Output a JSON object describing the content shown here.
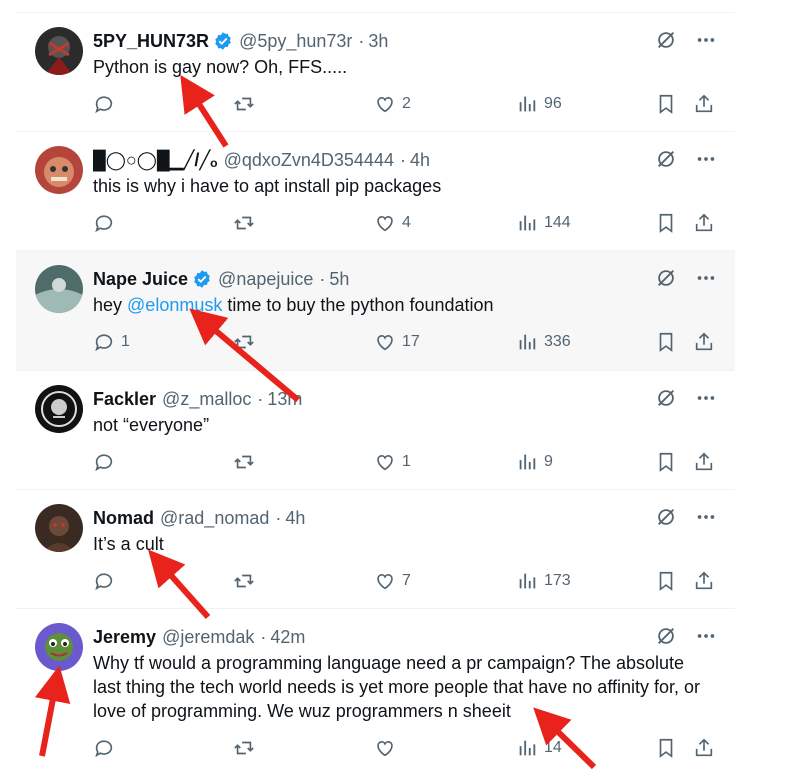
{
  "tweets": [
    {
      "name": "5PY_HUN73R",
      "verified": true,
      "handle": "@5py_hun73r",
      "time": "3h",
      "text": "Python is gay now? Oh, FFS.....",
      "mention": "",
      "text_after": "",
      "replies": "",
      "likes": "2",
      "views": "96",
      "avatar_color": "#2b2b2b",
      "highlight": false
    },
    {
      "name": "█◯○◯█▁╱/╱ₒ",
      "verified": false,
      "handle": "@qdxoZvn4D354444",
      "time": "4h",
      "text": "this is why i have to apt install pip packages",
      "mention": "",
      "text_after": "",
      "replies": "",
      "likes": "4",
      "views": "144",
      "avatar_color": "#b5453a",
      "highlight": false
    },
    {
      "name": "Nape Juice",
      "verified": true,
      "handle": "@napejuice",
      "time": "5h",
      "text": "hey ",
      "mention": "@elonmusk",
      "text_after": " time to buy the python foundation",
      "replies": "1",
      "likes": "17",
      "views": "336",
      "avatar_color": "#4f6b6a",
      "highlight": true
    },
    {
      "name": "Fackler",
      "verified": false,
      "handle": "@z_malloc",
      "time": "13m",
      "text": "not “everyone”",
      "mention": "",
      "text_after": "",
      "replies": "",
      "likes": "1",
      "views": "9",
      "avatar_color": "#111111",
      "highlight": false
    },
    {
      "name": "Nomad",
      "verified": false,
      "handle": "@rad_nomad",
      "time": "4h",
      "text": "It’s a cult",
      "mention": "",
      "text_after": "",
      "replies": "",
      "likes": "7",
      "views": "173",
      "avatar_color": "#3b2a22",
      "highlight": false
    },
    {
      "name": "Jeremy",
      "verified": false,
      "handle": "@jeremdak",
      "time": "42m",
      "text": "Why tf would a programming language need a pr campaign? The absolute last thing the tech world needs is yet more people that have no affinity for, or love of programming. We wuz programmers n sheeit",
      "mention": "",
      "text_after": "",
      "replies": "",
      "likes": "",
      "views": "14",
      "avatar_color": "#5f8f3a",
      "highlight": false
    }
  ],
  "colors": {
    "accent": "#1d9bf0",
    "muted": "#536471",
    "annotation": "#e8231c"
  },
  "icons": [
    "reply-icon",
    "retweet-icon",
    "like-icon",
    "views-icon",
    "bookmark-icon",
    "share-icon",
    "grok-icon",
    "more-icon",
    "verified-icon"
  ]
}
